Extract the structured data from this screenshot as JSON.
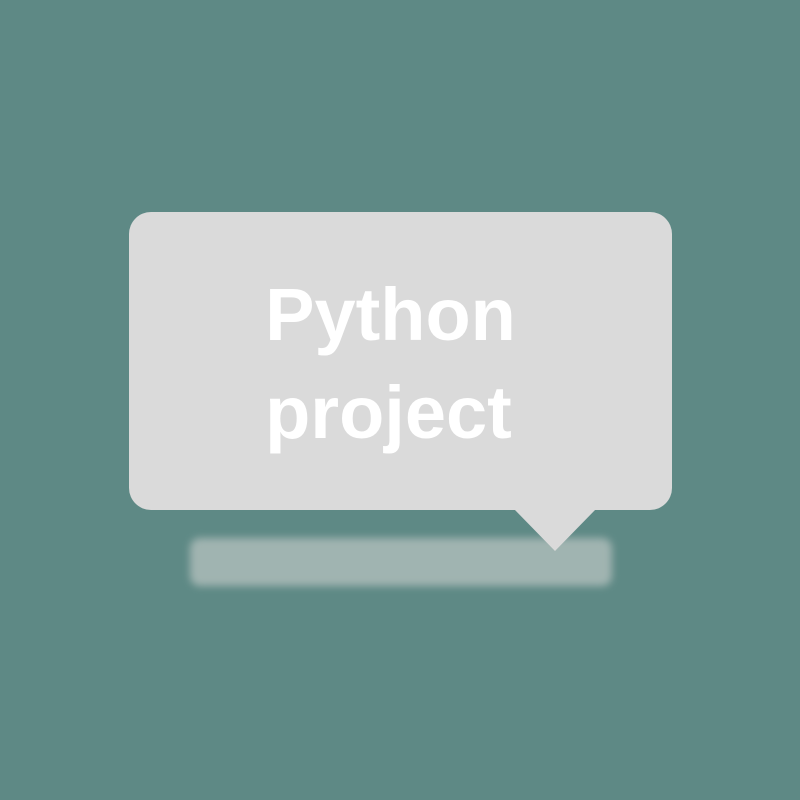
{
  "colors": {
    "background": "#5e8985",
    "bubble": "#dadada",
    "text": "#ffffff",
    "shadow_bar": "#a8b9b6"
  },
  "bubble": {
    "line1": "Python",
    "line2": "project"
  }
}
